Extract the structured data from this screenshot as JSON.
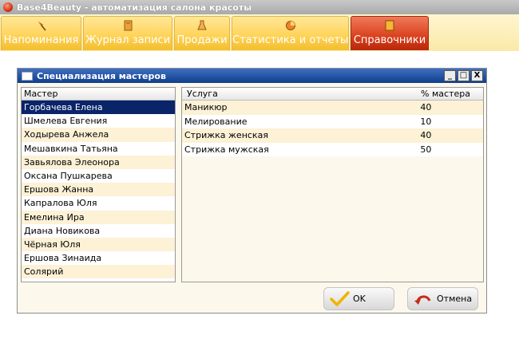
{
  "app": {
    "title": "Base4Beauty - автоматизация салона красоты",
    "tabs": [
      {
        "label": "Напоминания",
        "icon": "pin-icon"
      },
      {
        "label": "Журнал записи",
        "icon": "journal-icon"
      },
      {
        "label": "Продажи",
        "icon": "flask-icon"
      },
      {
        "label": "Статистика и отчеты",
        "icon": "pie-icon"
      },
      {
        "label": "Справочники",
        "icon": "book-icon",
        "active": true
      }
    ]
  },
  "dialog": {
    "title": "Специализация мастеров",
    "window_buttons": {
      "minimize": "_",
      "maximize": "□",
      "close": "X"
    },
    "masters": {
      "header": "Мастер",
      "items": [
        "Горбачева Елена",
        "Шмелева Евгения",
        "Ходырева Анжела",
        "Мешавкина Татьяна",
        "Завьялова  Элеонора",
        "Оксана Пушкарева",
        "Ершова Жанна",
        "Капралова Юля",
        "Емелина Ира",
        "Диана Новикова",
        "Чёрная Юля",
        "Ершова Зинаида",
        "Солярий"
      ],
      "selected_index": 0
    },
    "services": {
      "headers": {
        "service": "Услуга",
        "percent": "% мастера"
      },
      "rows": [
        {
          "service": "Маникюр",
          "percent": "40"
        },
        {
          "service": "Мелирование",
          "percent": "10"
        },
        {
          "service": "Стрижка женская",
          "percent": "40"
        },
        {
          "service": "Стрижка мужская",
          "percent": "50"
        }
      ]
    },
    "ok_label": "OK",
    "cancel_label": "Отмена"
  },
  "colors": {
    "tab_yellow": "#ffd45a",
    "tab_active": "#d9401c",
    "dialog_title": "#0f3e8c",
    "selection": "#0a246a"
  }
}
